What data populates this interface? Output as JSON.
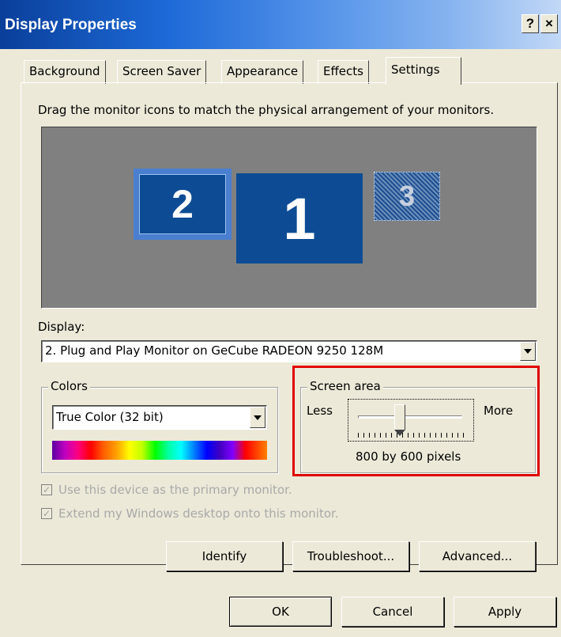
{
  "window": {
    "title": "Display Properties",
    "help_glyph": "?",
    "close_glyph": "×"
  },
  "tabs": [
    {
      "label": "Background"
    },
    {
      "label": "Screen Saver"
    },
    {
      "label": "Appearance"
    },
    {
      "label": "Effects"
    },
    {
      "label": "Settings",
      "active": true
    }
  ],
  "settings": {
    "instruction": "Drag the monitor icons to match the physical arrangement of your monitors.",
    "monitors": [
      {
        "number": "2",
        "selected": true
      },
      {
        "number": "1"
      },
      {
        "number": "3",
        "inactive": true
      }
    ],
    "display_label": "Display:",
    "display_value": "2. Plug and Play Monitor on GeCube RADEON 9250 128M",
    "colors": {
      "legend": "Colors",
      "value": "True Color (32 bit)"
    },
    "screen_area": {
      "legend": "Screen area",
      "less": "Less",
      "more": "More",
      "value_text": "800 by 600 pixels",
      "slider_fraction": 0.4
    },
    "checkboxes": [
      {
        "label": "Use this device as the primary monitor.",
        "checked": true,
        "disabled": true
      },
      {
        "label": "Extend my Windows desktop onto this monitor.",
        "checked": true,
        "disabled": true
      }
    ],
    "buttons": {
      "identify": "Identify",
      "troubleshoot": "Troubleshoot...",
      "advanced": "Advanced..."
    }
  },
  "footer": {
    "ok": "OK",
    "cancel": "Cancel",
    "apply": "Apply"
  },
  "colors": {
    "highlight": "#e00000",
    "monitor_blue": "#0d4c94"
  }
}
